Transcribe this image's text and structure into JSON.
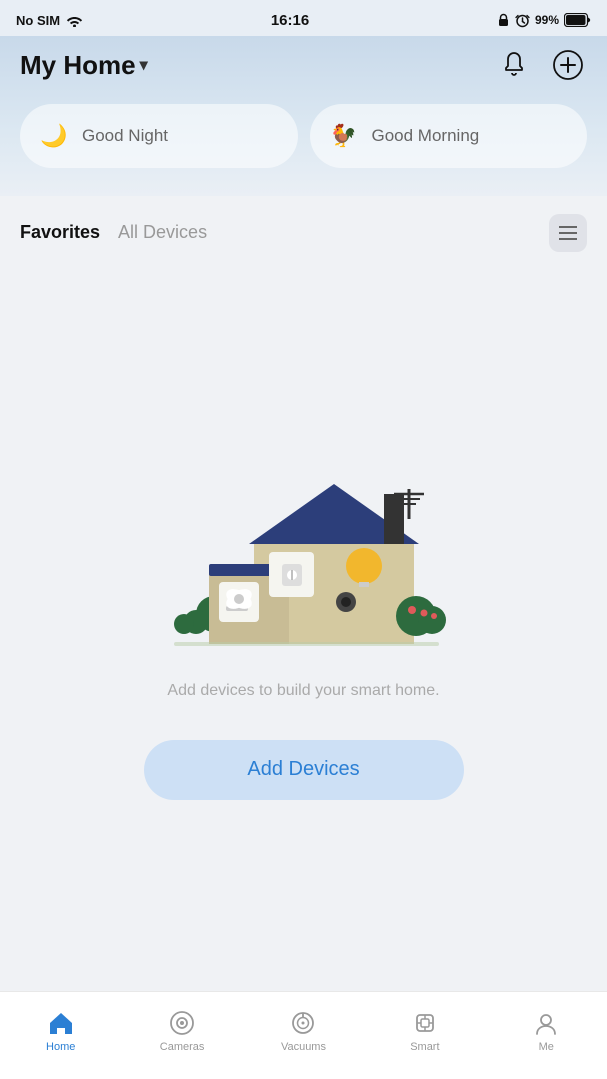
{
  "statusBar": {
    "carrier": "No SIM",
    "time": "16:16",
    "battery": "99%"
  },
  "header": {
    "title": "My Home",
    "chevron": "▾",
    "bell_label": "notifications",
    "add_label": "add"
  },
  "scenes": [
    {
      "id": "good-night",
      "label": "Good Night",
      "icon": "🌙"
    },
    {
      "id": "good-morning",
      "label": "Good Morning",
      "icon": "🐓"
    }
  ],
  "tabs": [
    {
      "id": "favorites",
      "label": "Favorites",
      "active": true
    },
    {
      "id": "all-devices",
      "label": "All Devices",
      "active": false
    }
  ],
  "emptyState": {
    "message": "Add devices to build your smart home.",
    "addButton": "Add Devices"
  },
  "bottomNav": [
    {
      "id": "home",
      "label": "Home",
      "active": true
    },
    {
      "id": "cameras",
      "label": "Cameras",
      "active": false
    },
    {
      "id": "vacuums",
      "label": "Vacuums",
      "active": false
    },
    {
      "id": "smart",
      "label": "Smart",
      "active": false
    },
    {
      "id": "me",
      "label": "Me",
      "active": false
    }
  ]
}
